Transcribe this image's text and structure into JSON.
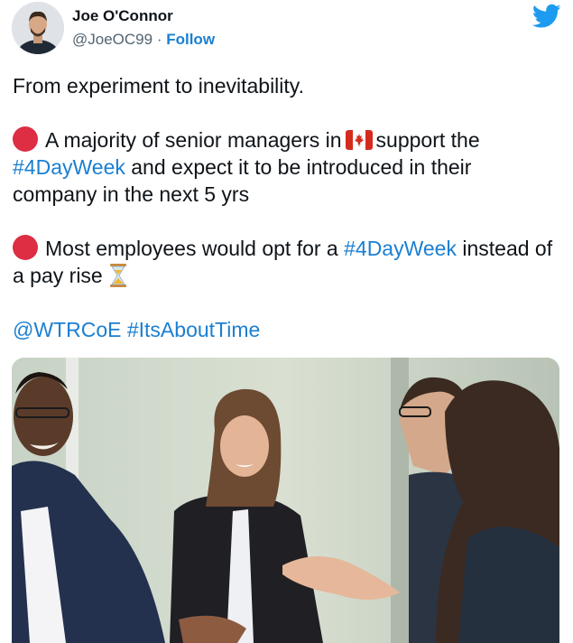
{
  "author": {
    "name": "Joe O'Connor",
    "handle": "@JoeOC99",
    "separator": "·",
    "follow_label": "Follow"
  },
  "tweet": {
    "line1": "From experiment to inevitability.",
    "p2_before": "A majority of senior managers in",
    "p2_after": "support the",
    "hashtag_4day_1": "#4DayWeek",
    "p2_tail": "and expect it to be introduced in their company in the next 5 yrs",
    "p3_before": "Most employees would opt for a",
    "hashtag_4day_2": "#4DayWeek",
    "p3_tail": "instead of a pay rise",
    "mention": "@WTRCoE",
    "hashtag_about": "#ItsAboutTime"
  },
  "icons": {
    "brand": "twitter-bird-icon",
    "bullet": "red-circle-icon",
    "flag": "canada-flag-icon",
    "time": "hourglass-icon"
  },
  "colors": {
    "link": "#1b7fd1",
    "twitter_blue": "#1d9bf0",
    "text": "#0f1419",
    "muted": "#536471",
    "red_circle": "#dd2e44"
  }
}
